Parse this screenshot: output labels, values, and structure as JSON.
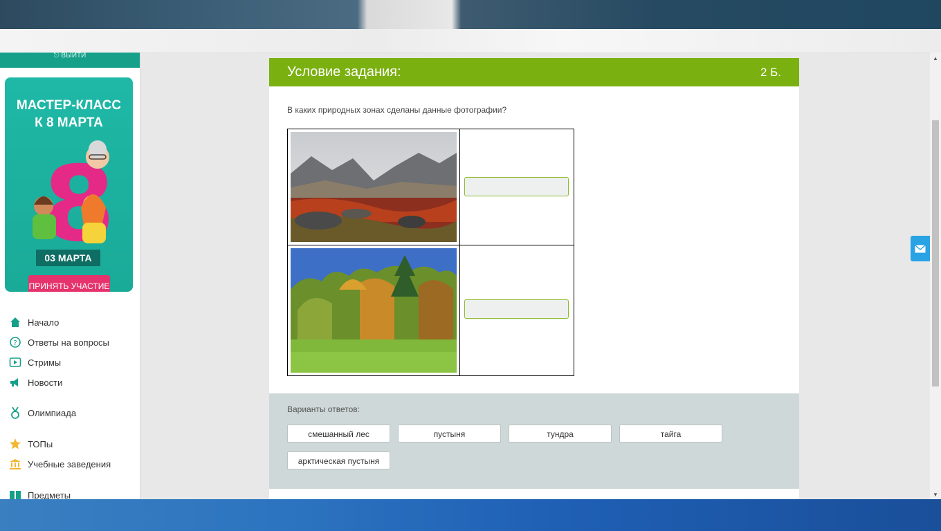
{
  "sidebar": {
    "logout_label": "ВЫЙТИ",
    "promo": {
      "title_line1": "МАСТЕР-КЛАСС",
      "title_line2": "К 8 МАРТА",
      "big_number": "8",
      "date": "03 МАРТА",
      "button_label": "ПРИНЯТЬ УЧАСТИЕ"
    },
    "items": [
      {
        "label": "Начало",
        "icon": "home-icon"
      },
      {
        "label": "Ответы на вопросы",
        "icon": "question-icon"
      },
      {
        "label": "Стримы",
        "icon": "play-icon"
      },
      {
        "label": "Новости",
        "icon": "megaphone-icon"
      },
      {
        "label": "Олимпиада",
        "icon": "medal-icon"
      },
      {
        "label": "ТОПы",
        "icon": "star-icon"
      },
      {
        "label": "Учебные заведения",
        "icon": "institution-icon"
      },
      {
        "label": "Предметы",
        "icon": "book-icon"
      }
    ]
  },
  "task": {
    "header_title": "Условие задания:",
    "points": "2 Б.",
    "question": "В каких природных зонах сделаны данные фотографии?",
    "answers_label": "Варианты ответов:",
    "options": [
      "смешанный лес",
      "пустыня",
      "тундра",
      "тайга",
      "арктическая пустыня"
    ]
  },
  "colors": {
    "header_green": "#7ab00f",
    "sidebar_teal": "#16a08a",
    "promo_button": "#e6336d",
    "answers_bg": "#cfd8d8",
    "mail_blue": "#29a3e4"
  }
}
